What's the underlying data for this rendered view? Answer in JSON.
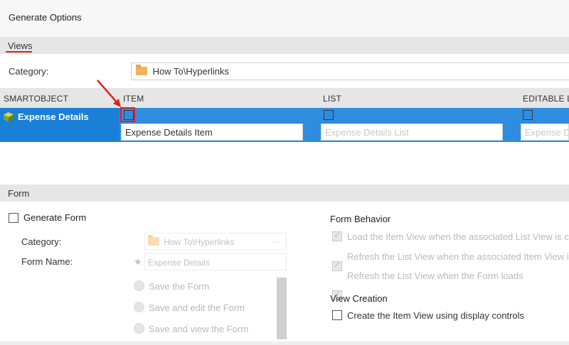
{
  "header": {
    "title": "Generate Options"
  },
  "views_section": {
    "tab_label": "Views",
    "category_label": "Category:",
    "category_value": "How To\\Hyperlinks",
    "columns": [
      "SMARTOBJECT",
      "ITEM",
      "LIST",
      "EDITABLE LI"
    ],
    "row": {
      "smartobject": "Expense Details",
      "item_name": "Expense Details Item",
      "list_placeholder": "Expense Details List",
      "editable_placeholder": "Expense De"
    }
  },
  "form_section": {
    "label": "Form",
    "generate_form_label": "Generate Form",
    "category_label": "Category:",
    "category_value": "How To\\Hyperlinks",
    "category_more": "···",
    "form_name_label": "Form Name:",
    "form_name_required": "★",
    "form_name_placeholder": "Expense Details",
    "save_options": [
      "Save the Form",
      "Save and edit the Form",
      "Save and view the Form"
    ],
    "behavior_title": "Form Behavior",
    "behavior_options": [
      "Load the Item View when the associated List View is cli",
      "Refresh the List View when the associated Item View is",
      "Refresh the List View when the Form loads"
    ],
    "view_creation_title": "View Creation",
    "view_creation_option": "Create the Item View using display controls"
  },
  "colors": {
    "selection": "#2e8ddf",
    "annotation": "#e02020",
    "section_bg": "#e6e6e6"
  }
}
